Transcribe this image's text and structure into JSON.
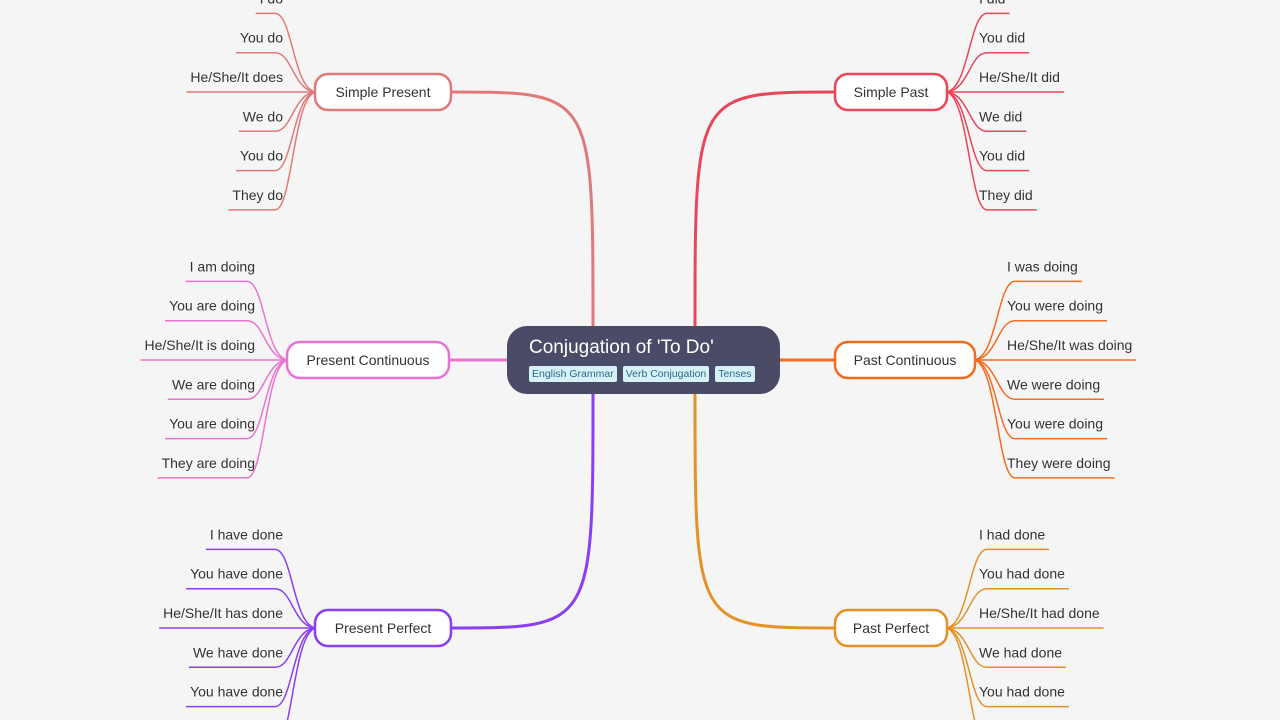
{
  "central": {
    "title": "Conjugation of 'To Do'",
    "tags": [
      "English Grammar",
      "Verb Conjugation",
      "Tenses"
    ],
    "color": "#4a4b67"
  },
  "branches": [
    {
      "topic": "Simple Present",
      "color": "#e07a7a",
      "side": "left",
      "leaves": [
        "I do",
        "You do",
        "He/She/It does",
        "We do",
        "You do",
        "They do"
      ]
    },
    {
      "topic": "Simple Past",
      "color": "#e8475a",
      "side": "right",
      "leaves": [
        "I did",
        "You did",
        "He/She/It did",
        "We did",
        "You did",
        "They did"
      ]
    },
    {
      "topic": "Present Continuous",
      "color": "#e874d2",
      "side": "left",
      "leaves": [
        "I am doing",
        "You are doing",
        "He/She/It is doing",
        "We are doing",
        "You are doing",
        "They are doing"
      ]
    },
    {
      "topic": "Past Continuous",
      "color": "#f56b1f",
      "side": "right",
      "leaves": [
        "I was doing",
        "You were doing",
        "He/She/It was doing",
        "We were doing",
        "You were doing",
        "They were doing"
      ]
    },
    {
      "topic": "Present Perfect",
      "color": "#8a3ff0",
      "side": "left",
      "leaves": [
        "I have done",
        "You have done",
        "He/She/It has done",
        "We have done",
        "You have done"
      ]
    },
    {
      "topic": "Past Perfect",
      "color": "#e3922a",
      "side": "right",
      "leaves": [
        "I had done",
        "You had done",
        "He/She/It had done",
        "We had done",
        "You had done"
      ]
    }
  ]
}
